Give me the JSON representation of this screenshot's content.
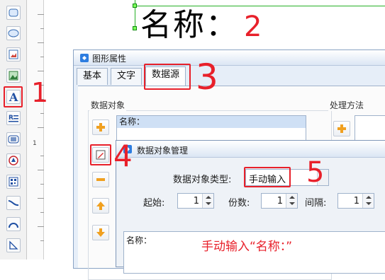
{
  "toolbar": {
    "tools": [
      {
        "name": "rounded-rect-icon"
      },
      {
        "name": "ellipse-icon"
      },
      {
        "name": "image-icon"
      },
      {
        "name": "picture-icon"
      },
      {
        "name": "text-tool-icon"
      },
      {
        "name": "rich-text-icon"
      },
      {
        "name": "barcode-icon"
      },
      {
        "name": "shapes-icon"
      },
      {
        "name": "qrcode-icon"
      },
      {
        "name": "curve-icon"
      },
      {
        "name": "arc-icon"
      },
      {
        "name": "polyline-icon"
      }
    ]
  },
  "ruler": {
    "marker": "1"
  },
  "canvas": {
    "label_text": "名称："
  },
  "properties_window": {
    "title": "图形属性",
    "tabs": [
      "基本",
      "文字",
      "数据源"
    ],
    "active_tab": "数据源",
    "data_objects_label": "数据对象",
    "processing_label": "处理方法",
    "object_list": [
      "名称："
    ]
  },
  "manager_dialog": {
    "title": "数据对象管理",
    "type_label": "数据对象类型:",
    "type_value": "手动输入",
    "start_label": "起始:",
    "start_value": "1",
    "copies_label": "份数:",
    "copies_value": "1",
    "interval_label": "间隔:",
    "interval_value": "1",
    "content": "名称："
  },
  "annotations": {
    "step1": "1",
    "step2": "2",
    "step3": "3",
    "step4": "4",
    "step5": "5",
    "instruction": "手动输入“名称：”"
  },
  "colors": {
    "annotation_red": "#e8202a",
    "guide_green": "#26b026",
    "window_frame": "#8aa3c4"
  }
}
